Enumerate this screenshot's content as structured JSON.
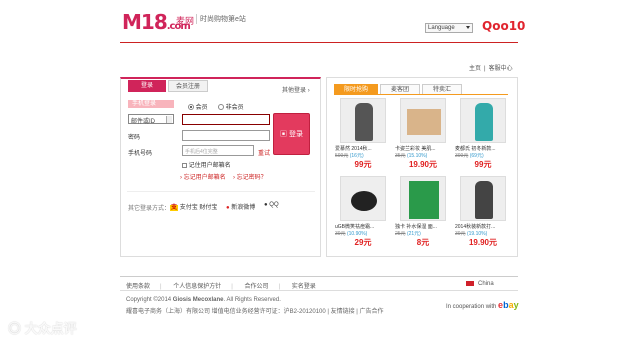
{
  "header": {
    "logo_main": "M18",
    "logo_sub": ".com",
    "logo_cn": "麦网",
    "tagline": "时尚购物第e站",
    "language_label": "Language",
    "partner_logo": "Qoo10",
    "links": [
      "主页",
      "客服中心"
    ]
  },
  "login": {
    "tabs": [
      "登录",
      "会员注册"
    ],
    "other_login": "其他登录",
    "phone_label": "手机登录",
    "member_options": [
      "会员",
      "非会员"
    ],
    "member_selected": 0,
    "id_type_select": "邮件或ID",
    "password_label": "密码",
    "phone_label2": "手机号码",
    "phone_placeholder": "手机后4位完整",
    "get_code": "重试",
    "remember_label": "记住用户邮箱名",
    "forgot_email": "忘记用户邮箱名",
    "forgot_password": "忘记密码？",
    "login_button": "登录",
    "other_methods_label": "其它登录方式：",
    "alipay": "支付宝",
    "tenpay": "财付宝",
    "weibo": "新浪微博",
    "qq": "QQ"
  },
  "deals": {
    "tabs": [
      "限时抢购",
      "麦客团",
      "特卖汇"
    ],
    "active_tab": 0,
    "products": [
      {
        "name": "爱慕然 2014秋...",
        "old": "599元",
        "disc": "(16元)",
        "price": "99元",
        "color": "#555"
      },
      {
        "name": "卡姿兰彩妆 美肌...",
        "old": "35元",
        "disc": "(15.10%)",
        "price": "19.90元",
        "color": "#d9b48a"
      },
      {
        "name": "麦都氏 初冬新款...",
        "old": "399元",
        "disc": "(69元)",
        "price": "99元",
        "color": "#3aa"
      },
      {
        "name": "uGB微笑祛痘霜...",
        "old": "39元",
        "disc": "(10.90%)",
        "price": "29元",
        "color": "#aaa"
      },
      {
        "name": "独卡 补水保湿 面...",
        "old": "25元",
        "disc": "(21元)",
        "price": "8元",
        "color": "#2a9a4a"
      },
      {
        "name": "2014秋装新款打...",
        "old": "39元",
        "disc": "(19.10%)",
        "price": "19.90元",
        "color": "#444"
      }
    ]
  },
  "footer": {
    "links": [
      "使用条款",
      "个人信息保护方针",
      "合作公司",
      "实名登录"
    ],
    "country": "China",
    "copyright_prefix": "Copyright ©2014",
    "company": "Giosis Mecoxlane",
    "rights": "All Rights Reserved.",
    "icp": "耀喜电子商务（上海）有限公司  增值电信业务经营许可证：沪B2-20120100 | 友情链接 | 广告合作",
    "cooperation": "In cooperation with",
    "ebay": "ebay"
  },
  "watermark": "大众点评"
}
